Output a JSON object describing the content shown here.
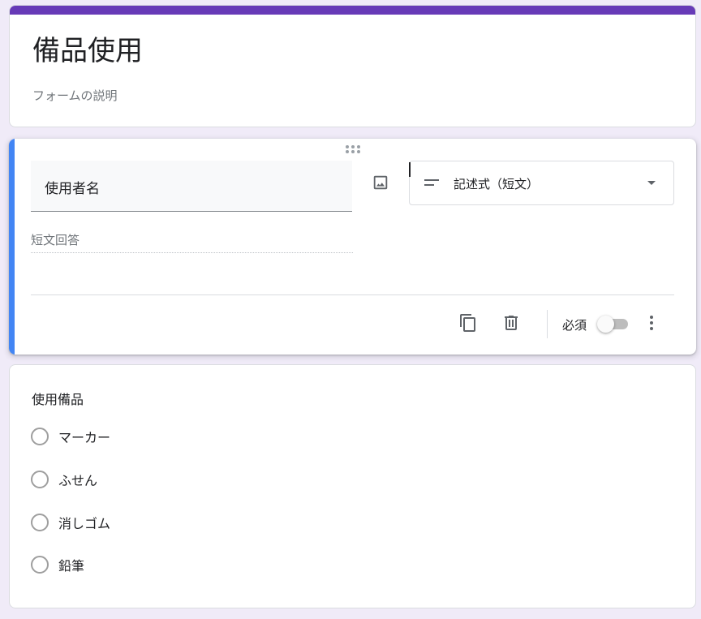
{
  "form": {
    "title": "備品使用",
    "description_placeholder": "フォームの説明"
  },
  "active_question": {
    "title": "使用者名",
    "type_label": "記述式（短文）",
    "answer_hint": "短文回答",
    "required_label": "必須",
    "required": false
  },
  "question2": {
    "title": "使用備品",
    "options": [
      "マーカー",
      "ふせん",
      "消しゴム",
      "鉛筆"
    ]
  },
  "icons": {
    "drag": "drag-handle-icon",
    "image": "image-icon",
    "short_answer": "short-text-icon",
    "dropdown": "arrow-drop-down-icon",
    "duplicate": "copy-icon",
    "delete": "trash-icon",
    "more": "more-vert-icon"
  },
  "colors": {
    "theme": "#673ab7",
    "active_accent": "#4285f4",
    "background": "#f0ebf8"
  }
}
